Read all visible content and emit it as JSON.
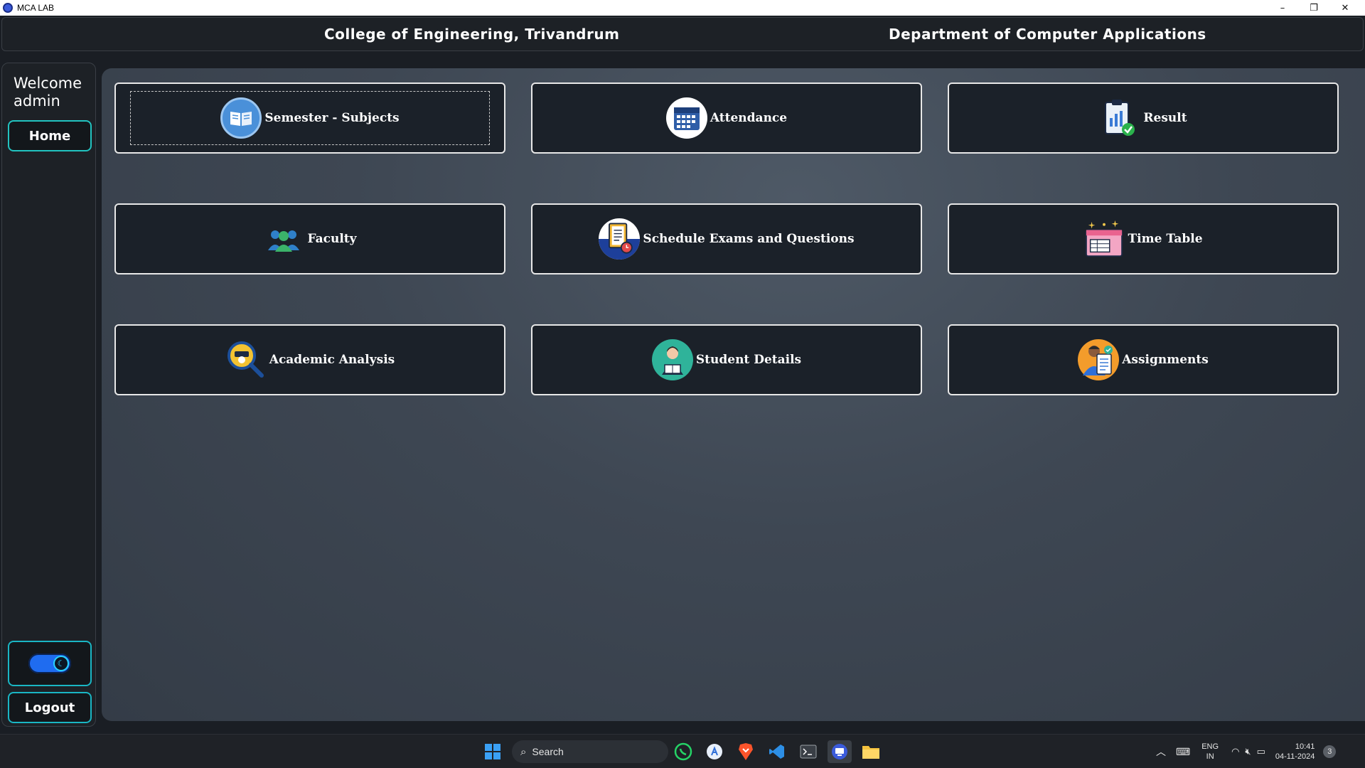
{
  "window": {
    "title": "MCA LAB",
    "minimize": "–",
    "restore": "❐",
    "close": "✕"
  },
  "header": {
    "college": "College of Engineering, Trivandrum",
    "department": "Department of Computer Applications"
  },
  "sidebar": {
    "welcome_line1": "Welcome",
    "welcome_line2": "admin",
    "home_label": "Home",
    "logout_label": "Logout",
    "theme_toggle_state": "on"
  },
  "tiles": [
    {
      "label": "Semester - Subjects",
      "icon": "book-icon"
    },
    {
      "label": "Attendance",
      "icon": "calendar-icon"
    },
    {
      "label": "Result",
      "icon": "clipboard-check-icon"
    },
    {
      "label": "Faculty",
      "icon": "group-icon"
    },
    {
      "label": "Schedule Exams and Questions",
      "icon": "exam-schedule-icon"
    },
    {
      "label": "Time Table",
      "icon": "timetable-icon"
    },
    {
      "label": "Academic Analysis",
      "icon": "analysis-magnifier-icon"
    },
    {
      "label": "Student Details",
      "icon": "student-icon"
    },
    {
      "label": "Assignments",
      "icon": "assignment-icon"
    }
  ],
  "taskbar": {
    "search_placeholder": "Search",
    "lang_line1": "ENG",
    "lang_line2": "IN",
    "time": "10:41",
    "date": "04-11-2024",
    "notification_count": "3"
  },
  "colors": {
    "accent": "#22c3c0",
    "tile_bg": "#1b2129",
    "panel_bg": "#3e4753"
  }
}
